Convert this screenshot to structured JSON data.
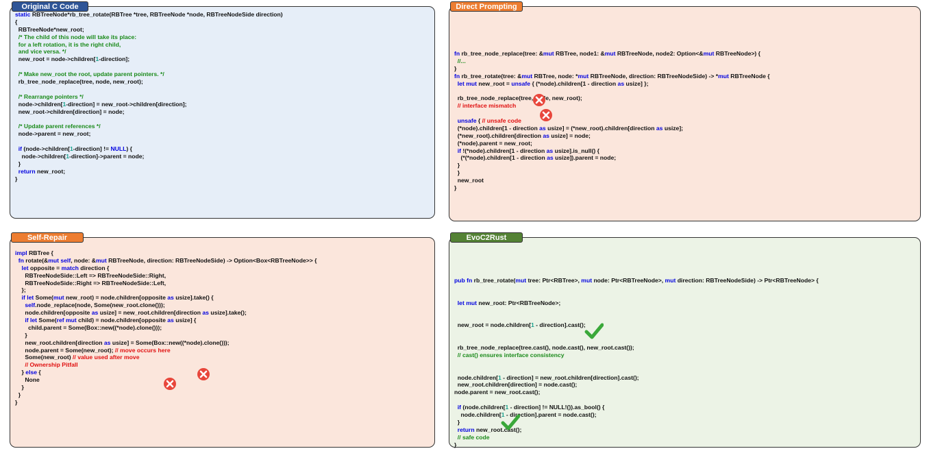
{
  "panels": {
    "c": {
      "title": "Original C Code"
    },
    "direct": {
      "title": "Direct Prompting"
    },
    "selfrepair": {
      "title": "Self-Repair"
    },
    "evo": {
      "title": "EvoC2Rust"
    }
  },
  "colors": {
    "c_bg": "#e6eef8",
    "c_tab": "#2f5597",
    "direct_bg": "#fbe6dc",
    "direct_tab": "#ed7d31",
    "selfrepair_bg": "#fbe6dc",
    "selfrepair_tab": "#ed7d31",
    "evo_bg": "#ecf3e6",
    "evo_tab": "#548235",
    "error": "#e8463b",
    "success": "#3aa83a"
  },
  "icons": {
    "error": "x-circle-icon",
    "success": "checkmark-icon"
  },
  "c_code": [
    [
      [
        "k",
        "static "
      ],
      [
        "",
        "RBTreeNode*rb_tree_rotate(RBTree *tree, RBTreeNode *node, RBTreeNodeSide direction)"
      ]
    ],
    [
      [
        "",
        "{"
      ]
    ],
    [
      [
        "",
        "  RBTreeNode*new_root;"
      ]
    ],
    [
      [
        "c",
        "  /* The child of this node will take its place:"
      ]
    ],
    [
      [
        "c",
        "  for a left rotation, it is the right child,"
      ]
    ],
    [
      [
        "c",
        "  and vice versa. */"
      ]
    ],
    [
      [
        "",
        "  new_root = node->children["
      ],
      [
        "n",
        "1"
      ],
      [
        "",
        "-direction];"
      ]
    ],
    [
      [
        "",
        ""
      ]
    ],
    [
      [
        "c",
        "  /* Make new_root the root, update parent pointers. */"
      ]
    ],
    [
      [
        "",
        "  rb_tree_node_replace(tree, node, new_root);"
      ]
    ],
    [
      [
        "",
        ""
      ]
    ],
    [
      [
        "c",
        "  /* Rearrange pointers */"
      ]
    ],
    [
      [
        "",
        "  node->children["
      ],
      [
        "n",
        "1"
      ],
      [
        "",
        "-direction] = new_root->children[direction];"
      ]
    ],
    [
      [
        "",
        "  new_root->children[direction] = node;"
      ]
    ],
    [
      [
        "",
        ""
      ]
    ],
    [
      [
        "c",
        "  /* Update parent references */"
      ]
    ],
    [
      [
        "",
        "  node->parent = new_root;"
      ]
    ],
    [
      [
        "",
        ""
      ]
    ],
    [
      [
        "k",
        "  if "
      ],
      [
        "",
        "(node->children["
      ],
      [
        "n",
        "1"
      ],
      [
        "",
        "-direction] != "
      ],
      [
        "k",
        "NULL"
      ],
      [
        "",
        ") {"
      ]
    ],
    [
      [
        "",
        "    node->children["
      ],
      [
        "n",
        "1"
      ],
      [
        "",
        "-direction]->parent = node;"
      ]
    ],
    [
      [
        "",
        "  }"
      ]
    ],
    [
      [
        "k",
        "  return "
      ],
      [
        "",
        "new_root;"
      ]
    ],
    [
      [
        "",
        "}"
      ]
    ]
  ],
  "direct_code": [
    [
      [
        "k",
        "fn "
      ],
      [
        "",
        "rb_tree_node_replace(tree: &"
      ],
      [
        "k",
        "mut "
      ],
      [
        "",
        "RBTree, node1: &"
      ],
      [
        "k",
        "mut "
      ],
      [
        "",
        "RBTreeNode, node2: Option<&"
      ],
      [
        "k",
        "mut "
      ],
      [
        "",
        "RBTreeNode>) {"
      ]
    ],
    [
      [
        "c",
        "  //..."
      ]
    ],
    [
      [
        "",
        "}"
      ]
    ],
    [
      [
        "k",
        "fn "
      ],
      [
        "",
        "rb_tree_rotate(tree: &"
      ],
      [
        "k",
        "mut "
      ],
      [
        "",
        "RBTree, node: *"
      ],
      [
        "k",
        "mut "
      ],
      [
        "",
        "RBTreeNode, direction: RBTreeNodeSide) -> *"
      ],
      [
        "k",
        "mut "
      ],
      [
        "",
        "RBTreeNode {"
      ]
    ],
    [
      [
        "k",
        "  let mut "
      ],
      [
        "",
        "new_root = "
      ],
      [
        "k",
        "unsafe "
      ],
      [
        "",
        "{ (*node).children[1 - direction "
      ],
      [
        "k",
        "as "
      ],
      [
        "",
        "usize] };"
      ]
    ],
    [
      [
        "",
        ""
      ]
    ],
    [
      [
        "",
        "  rb_tree_node_replace(tree, node, new_root);"
      ]
    ],
    [
      [
        "e",
        "  // interface mismatch"
      ]
    ],
    [
      [
        "",
        ""
      ]
    ],
    [
      [
        "k",
        "  unsafe "
      ],
      [
        "",
        "{ "
      ],
      [
        "e",
        "// unsafe code"
      ]
    ],
    [
      [
        "",
        "  (*node).children[1 - direction "
      ],
      [
        "k",
        "as "
      ],
      [
        "",
        "usize] = (*new_root).children[direction "
      ],
      [
        "k",
        "as "
      ],
      [
        "",
        "usize];"
      ]
    ],
    [
      [
        "",
        "  (*new_root).children[direction "
      ],
      [
        "k",
        "as "
      ],
      [
        "",
        "usize] = node;"
      ]
    ],
    [
      [
        "",
        "  (*node).parent = new_root;"
      ]
    ],
    [
      [
        "k",
        "  if "
      ],
      [
        "",
        "!(*node).children[1 - direction "
      ],
      [
        "k",
        "as "
      ],
      [
        "",
        "usize].is_null() {"
      ]
    ],
    [
      [
        "",
        "    (*(*node).children[1 - direction "
      ],
      [
        "k",
        "as "
      ],
      [
        "",
        "usize]).parent = node;"
      ]
    ],
    [
      [
        "",
        "  }"
      ]
    ],
    [
      [
        "",
        "  }"
      ]
    ],
    [
      [
        "",
        "  new_root"
      ]
    ],
    [
      [
        "",
        "}"
      ]
    ]
  ],
  "selfrepair_code": [
    [
      [
        "k",
        "impl "
      ],
      [
        "",
        "RBTree {"
      ]
    ],
    [
      [
        "k",
        "  fn "
      ],
      [
        "",
        "rotate(&"
      ],
      [
        "k",
        "mut self"
      ],
      [
        "",
        ", node: &"
      ],
      [
        "k",
        "mut "
      ],
      [
        "",
        "RBTreeNode, direction: RBTreeNodeSide) -> Option<Box<RBTreeNode>> {"
      ]
    ],
    [
      [
        "k",
        "    let "
      ],
      [
        "",
        "opposite = "
      ],
      [
        "k",
        "match "
      ],
      [
        "",
        "direction {"
      ]
    ],
    [
      [
        "",
        "      RBTreeNodeSide::Left => RBTreeNodeSide::Right,"
      ]
    ],
    [
      [
        "",
        "      RBTreeNodeSide::Right => RBTreeNodeSide::Left,"
      ]
    ],
    [
      [
        "",
        "    };"
      ]
    ],
    [
      [
        "k",
        "    if let "
      ],
      [
        "",
        "Some("
      ],
      [
        "k",
        "mut "
      ],
      [
        "",
        "new_root) = node.children[opposite "
      ],
      [
        "k",
        "as "
      ],
      [
        "",
        "usize].take() {"
      ]
    ],
    [
      [
        "k",
        "      self"
      ],
      [
        "",
        ".node_replace(node, Some(new_root.clone()));"
      ]
    ],
    [
      [
        "",
        "      node.children[opposite "
      ],
      [
        "k",
        "as "
      ],
      [
        "",
        "usize] = new_root.children[direction "
      ],
      [
        "k",
        "as "
      ],
      [
        "",
        "usize].take();"
      ]
    ],
    [
      [
        "k",
        "      if let "
      ],
      [
        "",
        "Some("
      ],
      [
        "k",
        "ref mut "
      ],
      [
        "",
        "child) = node.children[opposite "
      ],
      [
        "k",
        "as "
      ],
      [
        "",
        "usize] {"
      ]
    ],
    [
      [
        "",
        "        child.parent = Some(Box::new((*node).clone()));"
      ]
    ],
    [
      [
        "",
        "      }"
      ]
    ],
    [
      [
        "",
        "      new_root.children[direction "
      ],
      [
        "k",
        "as "
      ],
      [
        "",
        "usize] = Some(Box::new((*node).clone()));"
      ]
    ],
    [
      [
        "",
        "      node.parent = Some(new_root); "
      ],
      [
        "e",
        "// move occurs here"
      ]
    ],
    [
      [
        "",
        "      Some(new_root) "
      ],
      [
        "e",
        "// value used after move"
      ]
    ],
    [
      [
        "e",
        "      // Ownership Pitfall"
      ]
    ],
    [
      [
        "",
        "    } "
      ],
      [
        "k",
        "else "
      ],
      [
        "",
        "{"
      ]
    ],
    [
      [
        "",
        "      None"
      ]
    ],
    [
      [
        "",
        "    }"
      ]
    ],
    [
      [
        "",
        "  }"
      ]
    ],
    [
      [
        "",
        "}"
      ]
    ]
  ],
  "evo_code": [
    [
      [
        "k",
        "pub fn "
      ],
      [
        "",
        "rb_tree_rotate("
      ],
      [
        "k",
        "mut "
      ],
      [
        "",
        "tree: Ptr<RBTree>, "
      ],
      [
        "k",
        "mut "
      ],
      [
        "",
        "node: Ptr<RBTreeNode>, "
      ],
      [
        "k",
        "mut "
      ],
      [
        "",
        "direction: RBTreeNodeSide) -> Ptr<RBTreeNode> {"
      ]
    ],
    [
      [
        "",
        ""
      ]
    ],
    [
      [
        "",
        ""
      ]
    ],
    [
      [
        "k",
        "  let mut "
      ],
      [
        "",
        "new_root: Ptr<RBTreeNode>;"
      ]
    ],
    [
      [
        "",
        ""
      ]
    ],
    [
      [
        "",
        ""
      ]
    ],
    [
      [
        "",
        "  new_root = node.children["
      ],
      [
        "n",
        "1"
      ],
      [
        "",
        " - direction].cast();"
      ]
    ],
    [
      [
        "",
        ""
      ]
    ],
    [
      [
        "",
        ""
      ]
    ],
    [
      [
        "",
        "  rb_tree_node_replace(tree.cast(), node.cast(), new_root.cast());"
      ]
    ],
    [
      [
        "c",
        "  // cast() ensures interface consistency"
      ]
    ],
    [
      [
        "",
        ""
      ]
    ],
    [
      [
        "",
        ""
      ]
    ],
    [
      [
        "",
        "  node.children["
      ],
      [
        "n",
        "1"
      ],
      [
        "",
        " - direction] = new_root.children[direction].cast();"
      ]
    ],
    [
      [
        "",
        "  new_root.children[direction] = node.cast();"
      ]
    ],
    [
      [
        "",
        "node.parent = new_root.cast();"
      ]
    ],
    [
      [
        "",
        ""
      ]
    ],
    [
      [
        "k",
        "  if "
      ],
      [
        "",
        "(node.children["
      ],
      [
        "n",
        "1"
      ],
      [
        "",
        " - direction] != NULL!()).as_bool() {"
      ]
    ],
    [
      [
        "",
        "    node.children["
      ],
      [
        "n",
        "1"
      ],
      [
        "",
        " - direction].parent = node.cast();"
      ]
    ],
    [
      [
        "",
        "  }"
      ]
    ],
    [
      [
        "k",
        "  return "
      ],
      [
        "",
        "new_root.cast();"
      ]
    ],
    [
      [
        "c",
        "  // safe code"
      ]
    ],
    [
      [
        "",
        "}"
      ]
    ]
  ]
}
